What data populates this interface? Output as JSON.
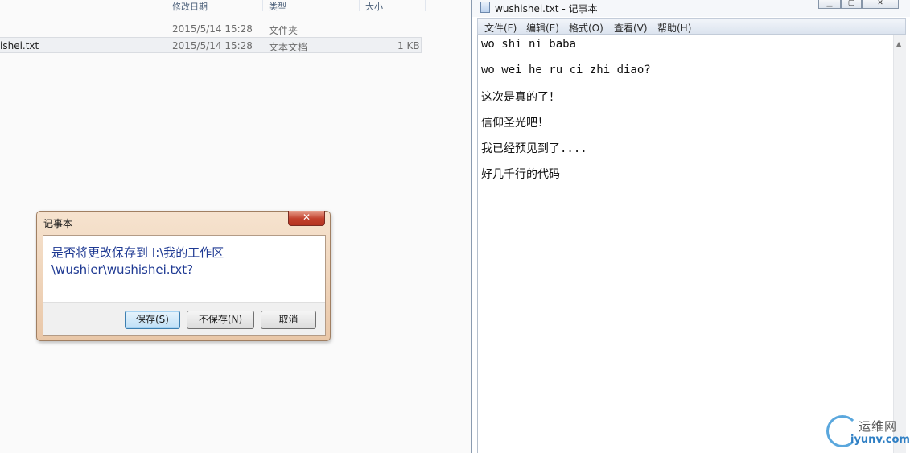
{
  "explorer": {
    "columns": {
      "date": "修改日期",
      "type": "类型",
      "size": "大小"
    },
    "rows": [
      {
        "name": "",
        "date": "2015/5/14 15:28",
        "type": "文件夹",
        "size": ""
      },
      {
        "name": "ishei.txt",
        "date": "2015/5/14 15:28",
        "type": "文本文档",
        "size": "1 KB"
      }
    ]
  },
  "notepad": {
    "title": "wushishei.txt - 记事本",
    "menu": [
      "文件(F)",
      "编辑(E)",
      "格式(O)",
      "查看(V)",
      "帮助(H)"
    ],
    "lines": [
      "wo shi ni baba",
      "wo wei he ru ci zhi diao?",
      "这次是真的了！",
      "信仰圣光吧！",
      "我已经预见到了....",
      "好几千行的代码"
    ]
  },
  "dialog": {
    "title": "记事本",
    "message": "是否将更改保存到 I:\\我的工作区\\wushier\\wushishei.txt?",
    "buttons": {
      "save": "保存(S)",
      "dont_save": "不保存(N)",
      "cancel": "取消"
    },
    "close_glyph": "✕"
  },
  "watermark": {
    "text_cn": "运维网",
    "text_en": "iyunv.com"
  },
  "colors": {
    "dialog_text": "#1f3a93",
    "dialog_frame": "#e9c7a8",
    "close_button": "#c2412d",
    "watermark": "#2f7fc4"
  }
}
